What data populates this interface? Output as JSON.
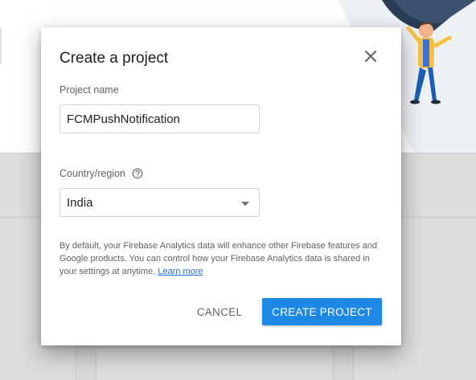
{
  "dialog": {
    "title": "Create a project",
    "close_icon": "close-icon",
    "project_name_label": "Project name",
    "project_name_value": "FCMPushNotification",
    "country_label": "Country/region",
    "help_icon": "help-circle-icon",
    "country_value": "India",
    "dropdown_icon": "dropdown-arrow-icon",
    "disclaimer_text": "By default, your Firebase Analytics data will enhance other Firebase features and Google products. You can control how your Firebase Analytics data is shared in your settings at anytime. ",
    "learn_more": "Learn more",
    "cancel_label": "CANCEL",
    "create_label": "CREATE PROJECT"
  },
  "colors": {
    "primary_button": "#1e88e5",
    "link": "#1a73e8",
    "overlay_background": "#dedede",
    "illustration_jacket": "#f6c141",
    "illustration_pants": "#1a5fb4",
    "illustration_curtain": "#2b3d55"
  },
  "background": {
    "illustration": "person-pulling-curtain-illustration"
  }
}
